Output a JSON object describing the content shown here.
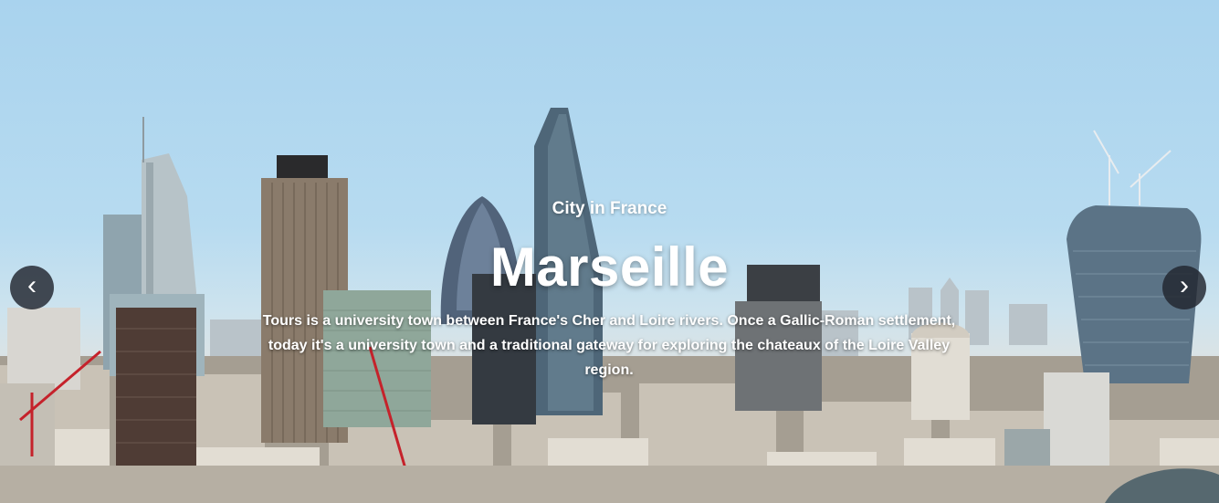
{
  "slider": {
    "subtitle": "City in France",
    "title": "Marseille",
    "description": "Tours is a university town between France's Cher and Loire rivers. Once a Gallic-Roman settlement, today it's a university town and a traditional gateway for exploring the chateaux of the Loire Valley region.",
    "prev_icon": "‹",
    "next_icon": "›"
  },
  "colors": {
    "sky_top": "#a9d3ee",
    "nav_button_bg": "#21252e",
    "caption_text": "#ffffff"
  },
  "icons": {
    "prev": "chevron-left-icon",
    "next": "chevron-right-icon"
  }
}
